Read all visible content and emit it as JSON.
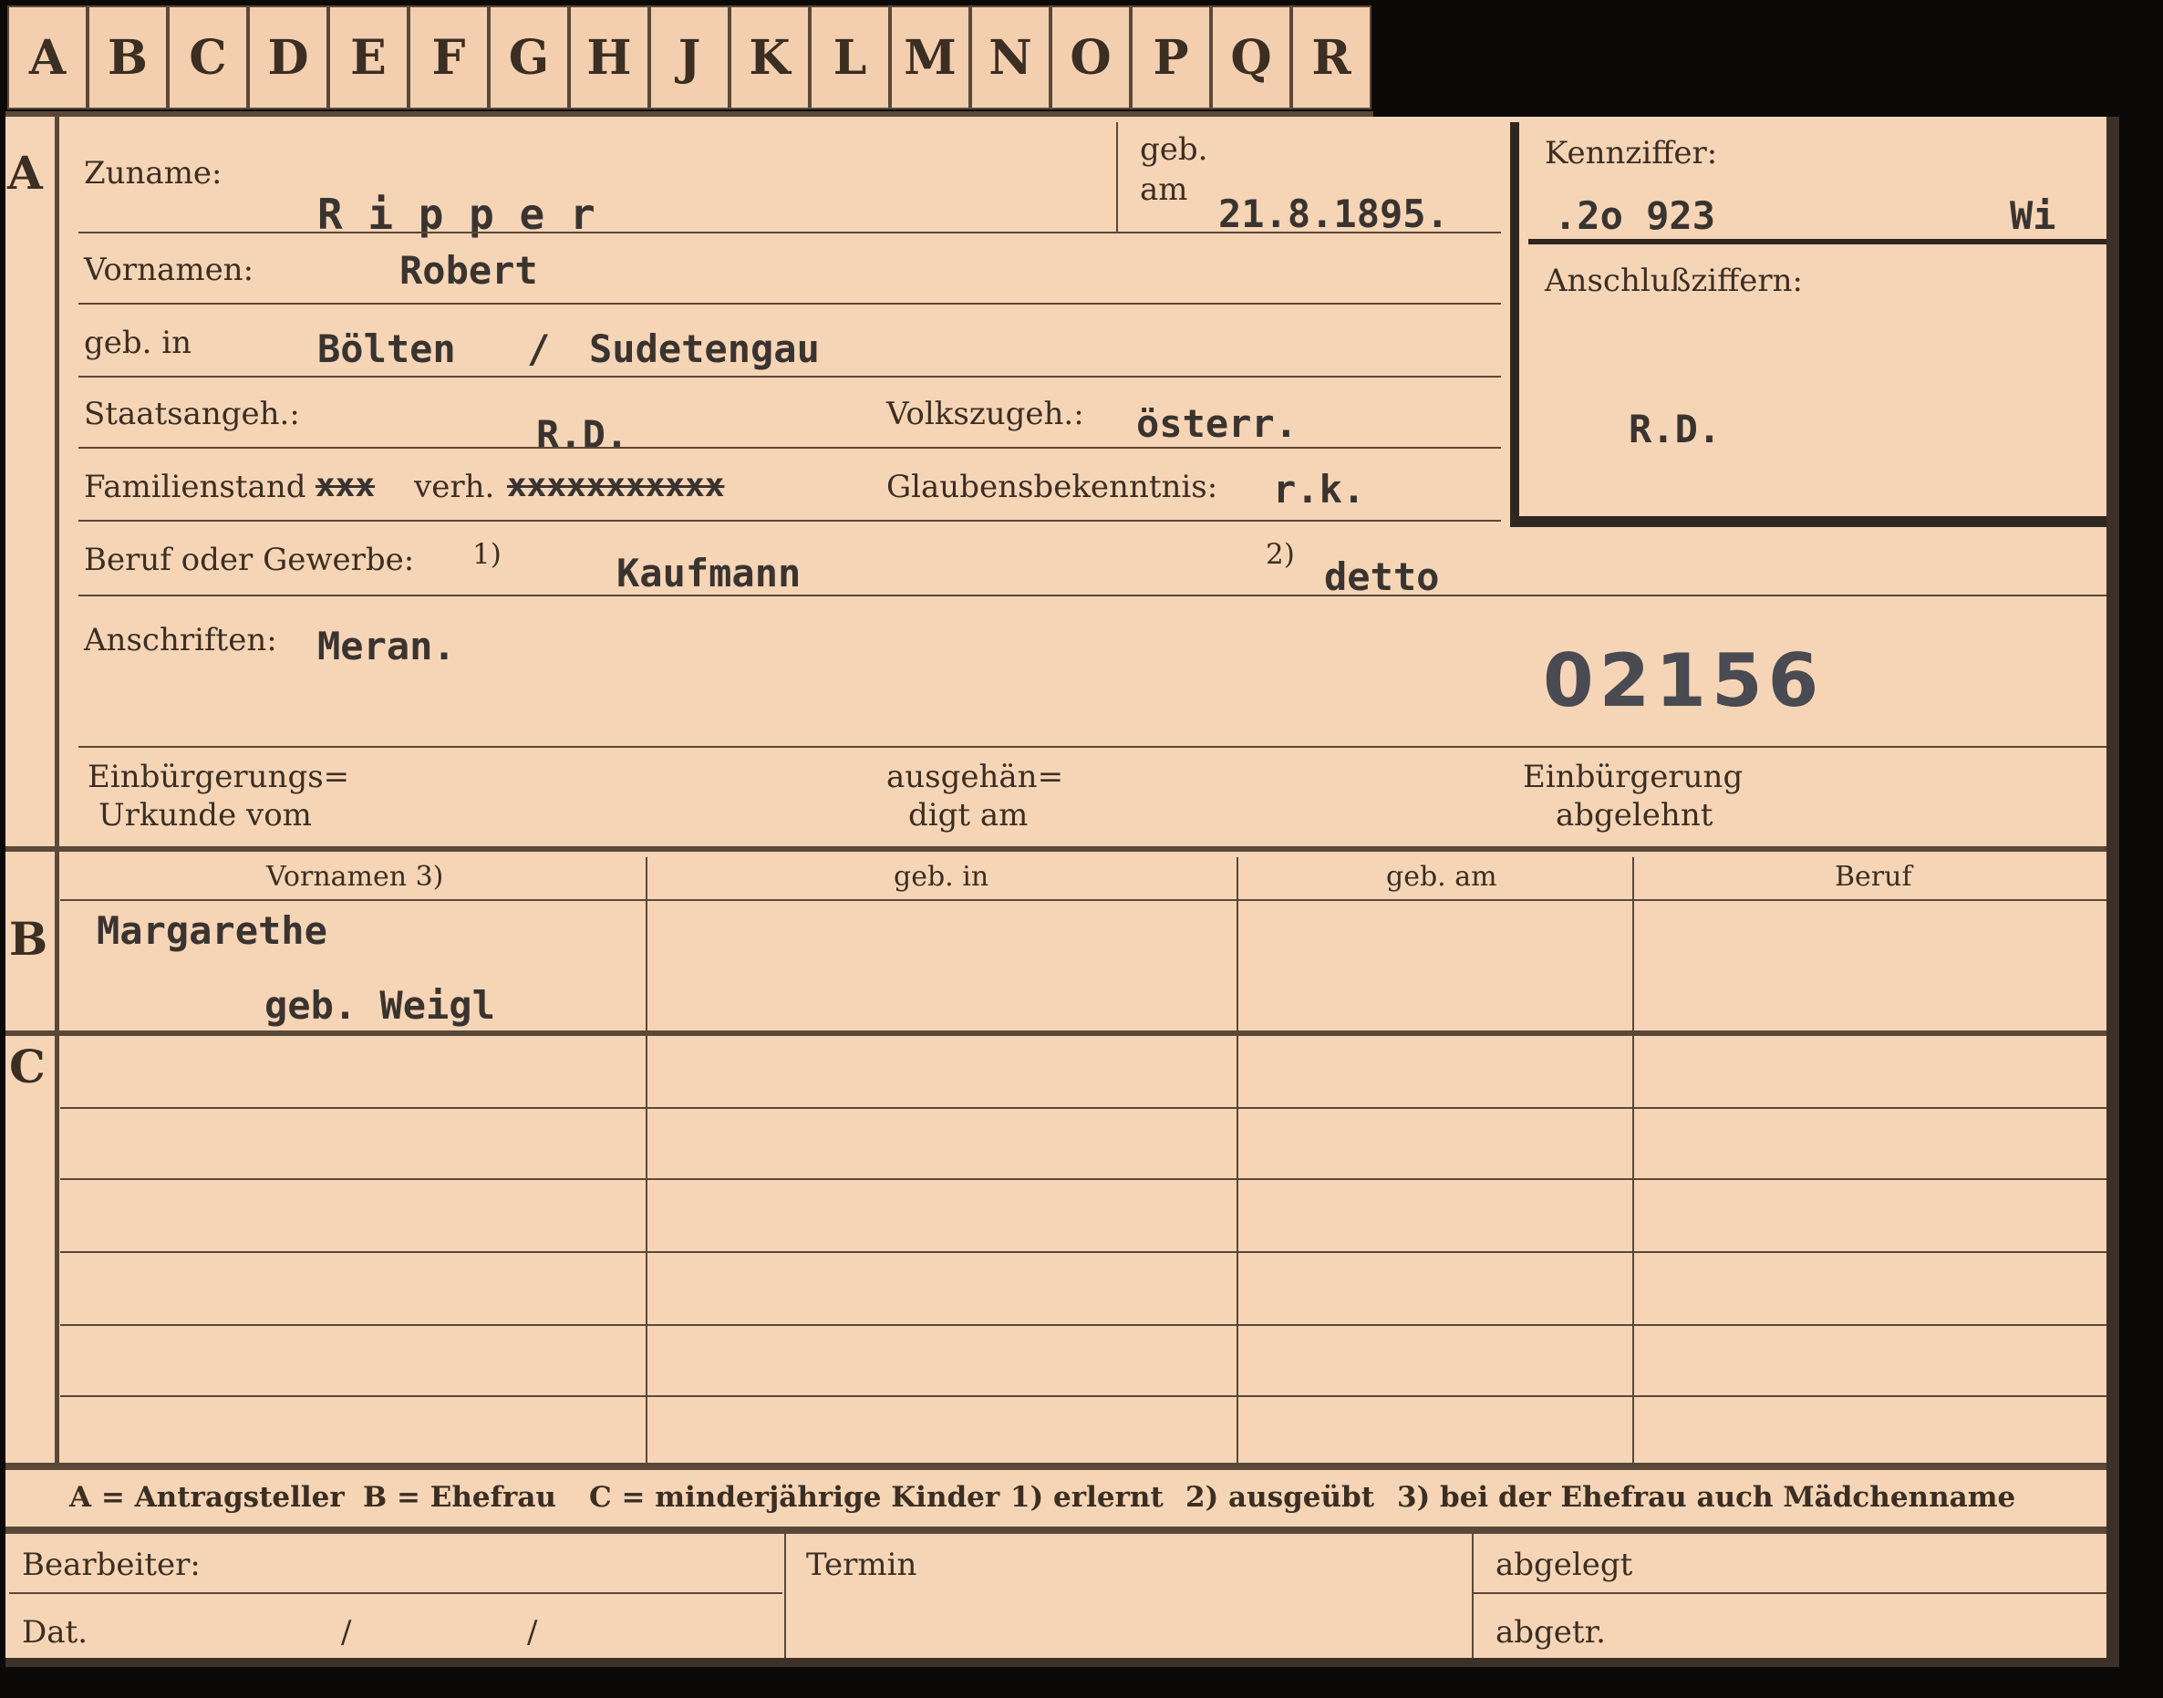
{
  "tabs": [
    "A",
    "B",
    "C",
    "D",
    "E",
    "F",
    "G",
    "H",
    "J",
    "K",
    "L",
    "M",
    "N",
    "O",
    "P",
    "Q",
    "R"
  ],
  "section_letters": {
    "a": "A",
    "b": "B",
    "c": "C"
  },
  "labels": {
    "zuname": "Zuname:",
    "geb": "geb.",
    "am": "am",
    "kennziffer": "Kennziffer:",
    "anschlussziffern": "Anschlußziffern:",
    "vornamen": "Vornamen:",
    "geb_in": "geb. in",
    "staatsangeh": "Staatsangeh.:",
    "volkszugeh": "Volkszugeh.:",
    "familienstand": "Familienstand",
    "verh": "verh.",
    "glaubensbekenntnis": "Glaubensbekenntnis:",
    "beruf": "Beruf oder Gewerbe:",
    "fn1": "1)",
    "fn2": "2)",
    "anschriften": "Anschriften:",
    "einbuergerungs": "Einbürgerungs=",
    "urkunde_vom": "Urkunde vom",
    "ausgehaen": "ausgehän=",
    "digt_am": "digt am",
    "einbuergerung": "Einbürgerung",
    "abgelehnt": "abgelehnt"
  },
  "values": {
    "zuname": "R i p p e r",
    "geb_am": "21.8.1895.",
    "kennziffer": ".2o 923",
    "kennziffer_suffix": "Wi",
    "anschluss": "R.D.",
    "vornamen": "Robert",
    "geb_in_ort": "Bölten",
    "geb_in_slash": "/",
    "geb_in_gau": "Sudetengau",
    "staatsangeh": "R.D.",
    "volkszugeh": "österr.",
    "familienstand_struck1": "xxx",
    "familienstand_struck2": "xxxxxxxxxxx",
    "glaube": "r.k.",
    "beruf1": "Kaufmann",
    "beruf2": "detto",
    "anschrift": "Meran.",
    "stamp_number": "02156"
  },
  "table_headers": {
    "vornamen": "Vornamen 3)",
    "geb_in": "geb. in",
    "geb_am": "geb. am",
    "beruf": "Beruf"
  },
  "row_b": {
    "line1": "Margarethe",
    "line2": "geb. Weigl"
  },
  "legend": {
    "a": "A = Antragsteller",
    "b": "B = Ehefrau",
    "c": "C = minderjährige Kinder",
    "n1": "1) erlernt",
    "n2": "2) ausgeübt",
    "n3": "3) bei der Ehefrau auch Mädchenname"
  },
  "footer": {
    "bearbeiter": "Bearbeiter:",
    "dat": "Dat.",
    "slash1": "/",
    "slash2": "/",
    "termin": "Termin",
    "abgelegt": "abgelegt",
    "abgetr": "abgetr."
  }
}
